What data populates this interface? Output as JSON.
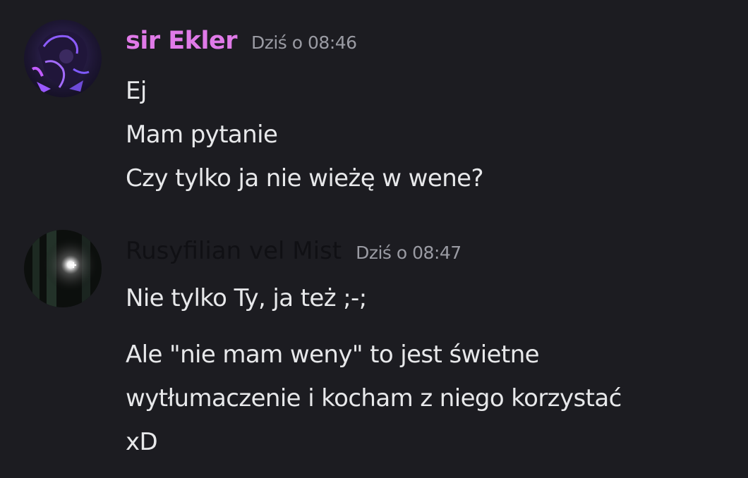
{
  "messages": [
    {
      "username": "sir Ekler",
      "timestamp": "Dziś o 08:46",
      "username_color": "#e07ae8",
      "avatar": "profile-avatar-purple-character",
      "lines": [
        "Ej",
        "Mam pytanie",
        "Czy tylko ja nie wieżę w wene?"
      ]
    },
    {
      "username": "Rusyfilian vel Mist",
      "timestamp": "Dziś o 08:47",
      "username_color": "#101014",
      "avatar": "profile-avatar-dark-light",
      "lines": [
        "Nie tylko Ty, ja też ;-;",
        "Ale \"nie mam weny\" to jest świetne",
        "wytłumaczenie i kocham z niego korzystać",
        "xD"
      ]
    }
  ]
}
